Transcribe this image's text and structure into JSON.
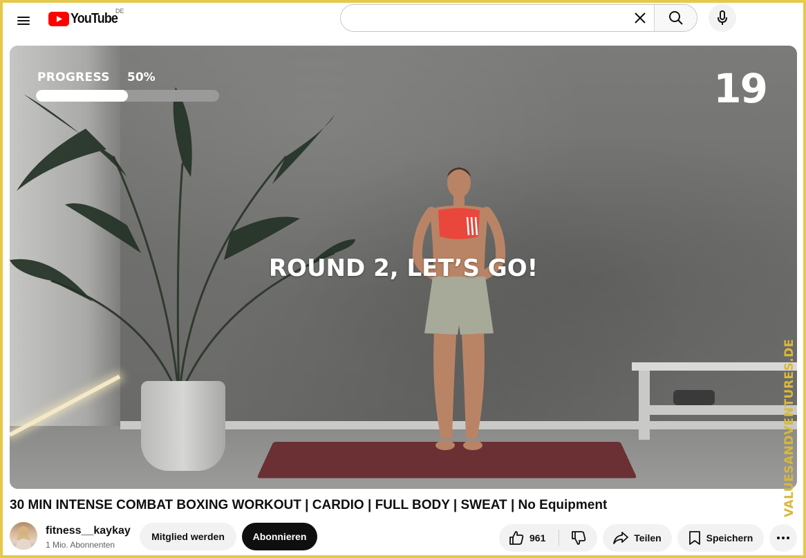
{
  "header": {
    "logo_text": "YouTube",
    "country_code": "DE",
    "search": {
      "value": "",
      "placeholder": ""
    }
  },
  "video": {
    "progress_label": "PROGRESS",
    "progress_value": "50%",
    "progress_fraction": 0.5,
    "timer": "19",
    "overlay_text": "ROUND 2, LET’S GO!",
    "watermark": "VALUESANDVENTURES.DE"
  },
  "info": {
    "title": "30 MIN INTENSE COMBAT BOXING WORKOUT | CARDIO | FULL BODY | SWEAT | No Equipment",
    "channel_name": "fitness__kaykay",
    "subscribers": "1 Mio. Abonnenten",
    "join_label": "Mitglied werden",
    "subscribe_label": "Abonnieren",
    "like_count": "961",
    "share_label": "Teilen",
    "save_label": "Speichern"
  },
  "colors": {
    "accent": "#ff0000",
    "frame": "#e6c84a",
    "watermark": "#d9b93a"
  },
  "icons": [
    "menu-icon",
    "youtube-logo-icon",
    "clear-icon",
    "search-icon",
    "mic-icon",
    "like-icon",
    "dislike-icon",
    "share-icon",
    "save-icon",
    "more-icon"
  ]
}
